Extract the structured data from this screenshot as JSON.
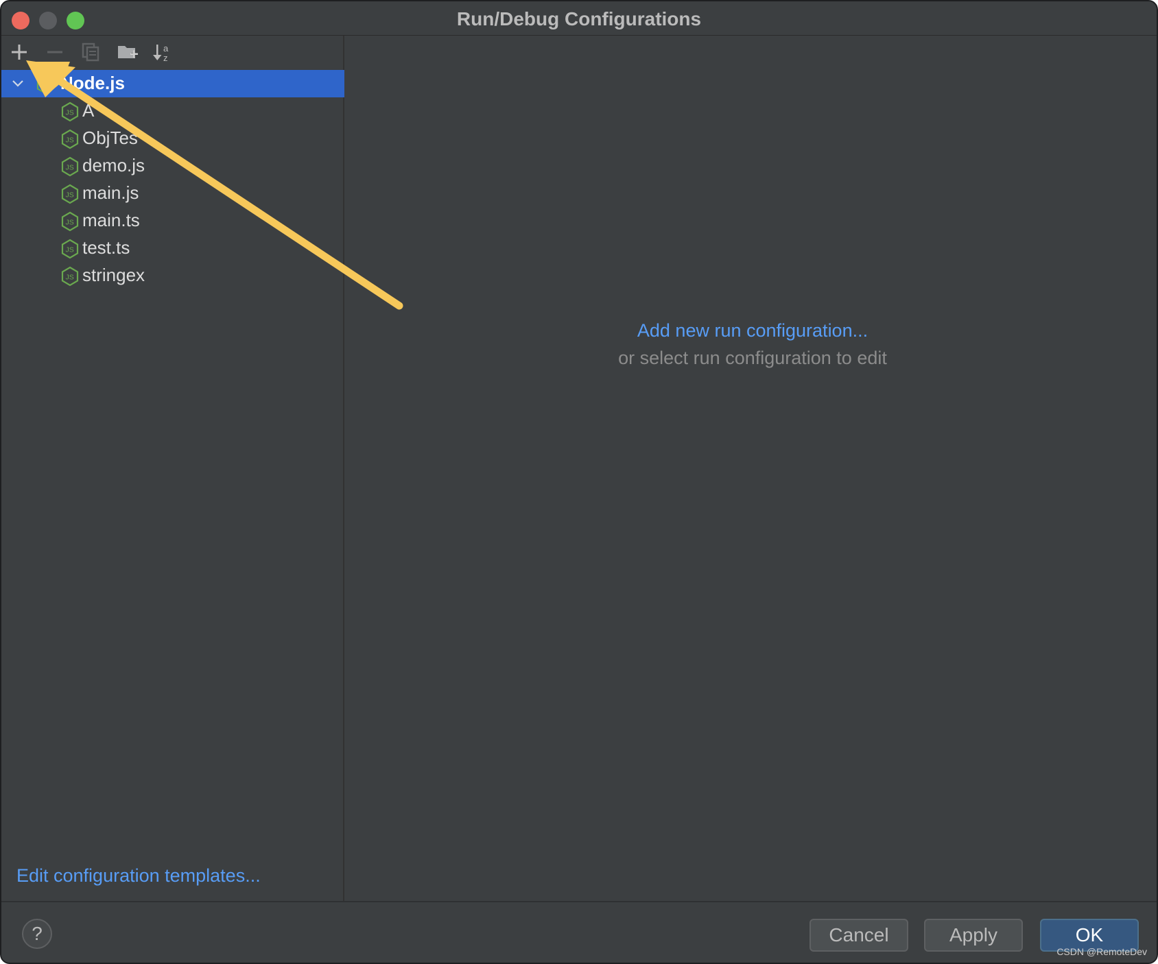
{
  "window": {
    "title": "Run/Debug Configurations"
  },
  "toolbar": {
    "buttons": [
      {
        "name": "add",
        "icon": "plus-icon",
        "enabled": true
      },
      {
        "name": "remove",
        "icon": "minus-icon",
        "enabled": false
      },
      {
        "name": "copy",
        "icon": "copy-icon",
        "enabled": false
      },
      {
        "name": "new-folder",
        "icon": "folder-plus-icon",
        "enabled": true
      },
      {
        "name": "sort",
        "icon": "sort-alpha-icon",
        "enabled": true
      }
    ]
  },
  "tree": {
    "root": {
      "label": "Node.js",
      "expanded": true,
      "selected": true,
      "icon": "nodejs-icon"
    },
    "items": [
      {
        "label": "A",
        "icon": "nodejs-icon"
      },
      {
        "label": "ObjTes",
        "icon": "nodejs-icon"
      },
      {
        "label": "demo.js",
        "icon": "nodejs-icon"
      },
      {
        "label": "main.js",
        "icon": "nodejs-icon"
      },
      {
        "label": "main.ts",
        "icon": "nodejs-icon"
      },
      {
        "label": "test.ts",
        "icon": "nodejs-icon"
      },
      {
        "label": "stringex",
        "icon": "nodejs-icon"
      }
    ]
  },
  "left_footer": {
    "edit_templates": "Edit configuration templates..."
  },
  "right_panel": {
    "add_link": "Add new run configuration...",
    "hint": "or select run configuration to edit"
  },
  "footer": {
    "help": "?",
    "cancel": "Cancel",
    "apply": "Apply",
    "ok": "OK"
  },
  "watermark": "CSDN @RemoteDev",
  "colors": {
    "background": "#3c3f41",
    "selection": "#2f65ca",
    "link": "#589df6",
    "ok_button": "#365880",
    "node_green": "#6aa84f",
    "annotation_arrow": "#f7c85a"
  }
}
